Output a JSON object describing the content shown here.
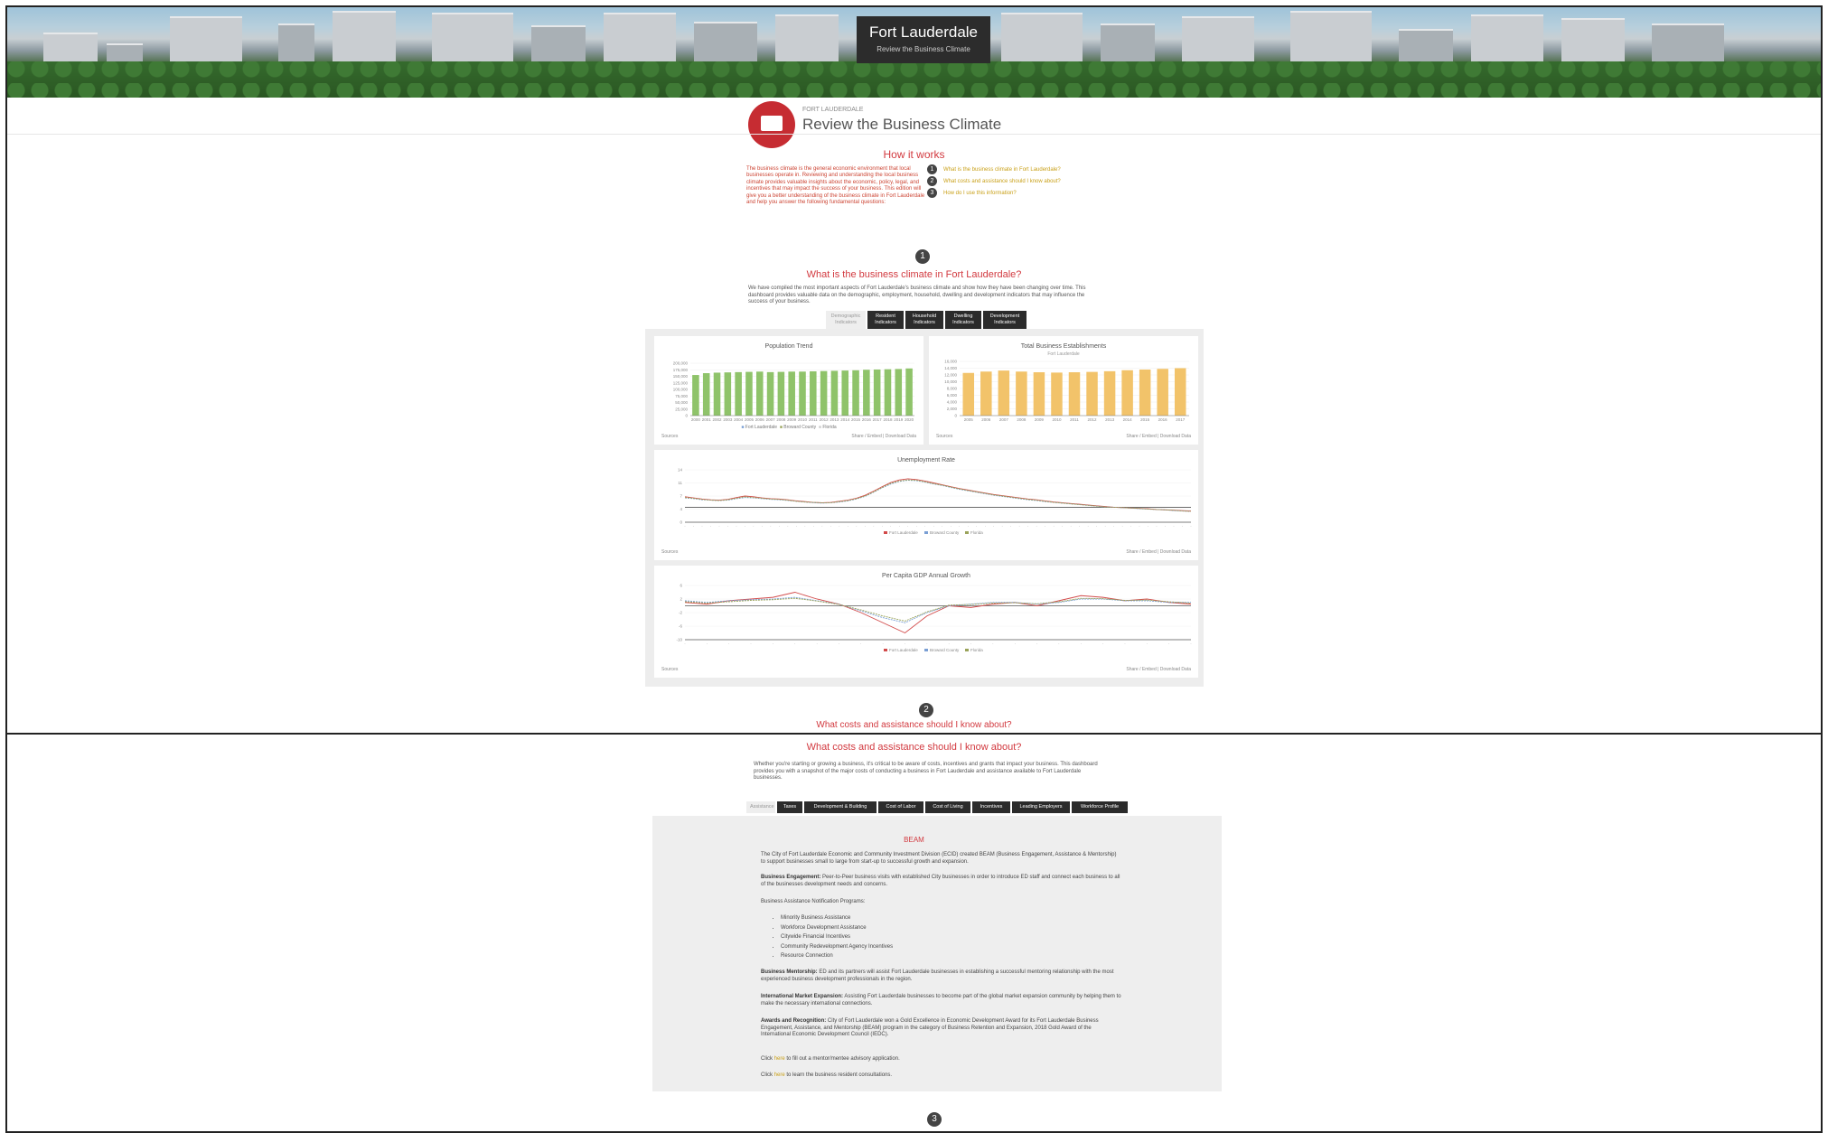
{
  "hero": {
    "title": "Fort Lauderdale",
    "subtitle": "Review the Business Climate"
  },
  "header": {
    "kicker": "FORT LAUDERDALE",
    "title": "Review the Business Climate"
  },
  "how_it_works": {
    "title": "How it works",
    "intro": "The business climate is the general economic environment that local businesses operate in. Reviewing and understanding the local business climate provides valuable insights about the economic, policy, legal, and incentives that may impact the success of your business. This edition will give you a better understanding of the business climate in Fort Lauderdale and help you answer the following fundamental questions:",
    "steps": [
      {
        "num": "1",
        "label": "What is the business climate in Fort Lauderdale?"
      },
      {
        "num": "2",
        "label": "What costs and assistance should I know about?"
      },
      {
        "num": "3",
        "label": "How do I use this information?"
      }
    ]
  },
  "section1": {
    "num": "1",
    "title": "What is the business climate in Fort Lauderdale?",
    "text": "We have compiled the most important aspects of Fort Lauderdale's business climate and show how they have been changing over time. This dashboard provides valuable data on the demographic, employment, household, dwelling and development indicators that may influence the success of your business.",
    "tabs": [
      {
        "label": "Demographic Indicators",
        "active": true
      },
      {
        "label": "Resident Indicators",
        "active": false
      },
      {
        "label": "Household Indicators",
        "active": false
      },
      {
        "label": "Dwelling Indicators",
        "active": false
      },
      {
        "label": "Development Indicators",
        "active": false
      }
    ]
  },
  "charts_ui": {
    "source": "Sources",
    "actions": "Share / Embed  |  Download Data"
  },
  "chart_data": [
    {
      "type": "bar",
      "title": "Population Trend",
      "categories": [
        "2000",
        "2001",
        "2002",
        "2003",
        "2004",
        "2005",
        "2006",
        "2007",
        "2008",
        "2009",
        "2010",
        "2011",
        "2012",
        "2013",
        "2014",
        "2015",
        "2016",
        "2017",
        "2018",
        "2019",
        "2020"
      ],
      "values": [
        155000,
        162000,
        164000,
        165000,
        166000,
        167000,
        168000,
        166000,
        167000,
        168000,
        168000,
        169000,
        170000,
        171000,
        172000,
        173000,
        175000,
        176000,
        177000,
        178000,
        180000
      ],
      "ylim": [
        0,
        200000
      ],
      "yticks": [
        "0",
        "25,000",
        "50,000",
        "75,000",
        "100,000",
        "125,000",
        "150,000",
        "175,000",
        "200,000"
      ],
      "color": "#8fc36a",
      "legend": [
        "Fort Lauderdale",
        "Broward County",
        "Florida"
      ]
    },
    {
      "type": "bar",
      "title": "Total Business Establishments",
      "subtitle": "Fort Lauderdale",
      "categories": [
        "2005",
        "2006",
        "2007",
        "2008",
        "2009",
        "2010",
        "2011",
        "2012",
        "2013",
        "2014",
        "2015",
        "2016",
        "2017"
      ],
      "values": [
        12600,
        13000,
        13300,
        13000,
        12800,
        12700,
        12800,
        12900,
        13100,
        13400,
        13600,
        13800,
        14000
      ],
      "ylim": [
        0,
        16000
      ],
      "yticks": [
        "0",
        "2,000",
        "4,000",
        "6,000",
        "8,000",
        "10,000",
        "12,000",
        "14,000",
        "16,000"
      ],
      "color": "#f2c36a"
    },
    {
      "type": "line",
      "title": "Unemployment Rate",
      "x_count": 60,
      "series": [
        {
          "name": "Fort Lauderdale",
          "color": "#d24a4a",
          "values": [
            6.8,
            6.5,
            6.2,
            6.0,
            5.9,
            6.1,
            6.6,
            7.0,
            6.8,
            6.5,
            6.3,
            6.2,
            6.0,
            5.7,
            5.5,
            5.3,
            5.2,
            5.3,
            5.6,
            5.9,
            6.4,
            7.2,
            8.3,
            9.5,
            10.6,
            11.3,
            11.6,
            11.4,
            11.0,
            10.5,
            10.0,
            9.5,
            9.0,
            8.6,
            8.2,
            7.8,
            7.4,
            7.1,
            6.8,
            6.5,
            6.2,
            6.0,
            5.7,
            5.4,
            5.2,
            5.0,
            4.8,
            4.6,
            4.4,
            4.2,
            4.0,
            3.9,
            3.8,
            3.7,
            3.6,
            3.4,
            3.3,
            3.2,
            3.1,
            3.0
          ]
        },
        {
          "name": "Broward County",
          "color": "#7a9fd4",
          "values": [
            6.5,
            6.3,
            6.0,
            5.9,
            5.8,
            5.9,
            6.3,
            6.6,
            6.5,
            6.3,
            6.1,
            6.0,
            5.8,
            5.6,
            5.4,
            5.2,
            5.1,
            5.2,
            5.4,
            5.7,
            6.2,
            6.9,
            8.0,
            9.2,
            10.2,
            10.9,
            11.2,
            11.1,
            10.7,
            10.2,
            9.8,
            9.3,
            8.8,
            8.4,
            8.0,
            7.6,
            7.2,
            6.9,
            6.6,
            6.3,
            6.0,
            5.8,
            5.5,
            5.3,
            5.1,
            4.9,
            4.7,
            4.5,
            4.3,
            4.1,
            4.0,
            3.9,
            3.8,
            3.6,
            3.5,
            3.4,
            3.3,
            3.1,
            3.0,
            2.9
          ]
        },
        {
          "name": "Florida",
          "color": "#9aa35a",
          "values": [
            6.6,
            6.4,
            6.1,
            5.9,
            5.8,
            6.0,
            6.4,
            6.8,
            6.6,
            6.4,
            6.2,
            6.1,
            5.9,
            5.6,
            5.4,
            5.3,
            5.2,
            5.2,
            5.5,
            5.8,
            6.3,
            7.0,
            8.1,
            9.3,
            10.4,
            11.0,
            11.3,
            11.2,
            10.8,
            10.3,
            9.9,
            9.4,
            8.9,
            8.5,
            8.1,
            7.7,
            7.3,
            7.0,
            6.7,
            6.4,
            6.1,
            5.9,
            5.6,
            5.3,
            5.1,
            4.9,
            4.7,
            4.5,
            4.3,
            4.1,
            4.0,
            3.9,
            3.8,
            3.7,
            3.5,
            3.4,
            3.3,
            3.2,
            3.0,
            2.9
          ]
        }
      ],
      "ylim": [
        0,
        14
      ],
      "refline": 4
    },
    {
      "type": "line",
      "title": "Per Capita GDP Annual Growth",
      "x_count": 24,
      "series": [
        {
          "name": "Fort Lauderdale",
          "color": "#d24a4a",
          "values": [
            1.0,
            0.5,
            1.5,
            2.0,
            2.5,
            4.0,
            2.0,
            0.5,
            -2.0,
            -5.0,
            -8.0,
            -3.0,
            0.0,
            -0.5,
            0.5,
            1.0,
            0.0,
            1.5,
            3.0,
            2.5,
            1.5,
            2.0,
            1.0,
            0.5
          ]
        },
        {
          "name": "Broward County",
          "color": "#7a9fd4",
          "values": [
            1.5,
            1.0,
            1.5,
            1.8,
            2.0,
            2.5,
            1.5,
            0.5,
            -1.5,
            -3.5,
            -5.0,
            -2.0,
            0.0,
            0.5,
            1.0,
            1.0,
            0.5,
            1.0,
            2.0,
            2.0,
            1.5,
            1.5,
            1.0,
            1.0
          ]
        },
        {
          "name": "Florida",
          "color": "#9aa35a",
          "values": [
            1.2,
            0.8,
            1.2,
            1.6,
            1.8,
            2.2,
            1.4,
            0.4,
            -1.2,
            -3.0,
            -4.5,
            -1.8,
            0.2,
            0.4,
            0.8,
            0.9,
            0.6,
            1.2,
            2.2,
            2.1,
            1.6,
            1.7,
            1.2,
            0.8
          ]
        }
      ],
      "ylim": [
        -10,
        6
      ],
      "refline": 0
    }
  ],
  "divider": {
    "num": "2",
    "caption": "What costs and assistance should I know about?"
  },
  "section2": {
    "title": "What costs and assistance should I know about?",
    "text": "Whether you're starting or growing a business, it's critical to be aware of costs, incentives and grants that impact your business. This dashboard provides you with a snapshot of the major costs of conducting a business in Fort Lauderdale and assistance available to Fort Lauderdale businesses.",
    "tabs": [
      {
        "label": "Assistance",
        "active": true
      },
      {
        "label": "Taxes",
        "active": false
      },
      {
        "label": "Development & Building",
        "active": false
      },
      {
        "label": "Cost of Labor",
        "active": false
      },
      {
        "label": "Cost of Living",
        "active": false
      },
      {
        "label": "Incentives",
        "active": false
      },
      {
        "label": "Leading Employers",
        "active": false
      },
      {
        "label": "Workforce Profile",
        "active": false
      }
    ],
    "panel_title": "BEAM",
    "p1": "The City of Fort Lauderdale Economic and Community Investment Division (ECID) created BEAM (Business Engagement, Assistance & Mentorship) to support businesses small to large from start-up to successful growth and expansion.",
    "p2_b": "Business Engagement:",
    "p2": "Peer-to-Peer business visits with established City businesses in order to introduce ED staff and connect each business to all of the businesses development needs and concerns.",
    "p3": "Business Assistance Notification Programs:",
    "bullets": [
      "Minority Business Assistance",
      "Workforce Development Assistance",
      "Citywide Financial Incentives",
      "Community Redevelopment Agency Incentives",
      "Resource Connection"
    ],
    "p4_b": "Business Mentorship:",
    "p4": "ED and its partners will assist Fort Lauderdale businesses in establishing a successful mentoring relationship with the most experienced business development professionals in the region.",
    "p5_b": "International Market Expansion:",
    "p5": "Assisting Fort Lauderdale businesses to become part of the global market expansion community by helping them to make the necessary international connections.",
    "p6_b": "Awards and Recognition:",
    "p6": "City of Fort Lauderdale won a Gold Excellence in Economic Development Award for its Fort Lauderdale Business Engagement, Assistance, and Mentorship (BEAM) program in the category of Business Retention and Expansion, 2018 Gold Award of the International Economic Development Council (IEDC).",
    "p7_pre": "Click",
    "p7_link": "here",
    "p7": "to fill out a mentor/mentee advisory application.",
    "p8_pre": "Click",
    "p8_link": "here",
    "p8": "to learn the business resident consultations."
  },
  "section3": {
    "num": "3"
  }
}
